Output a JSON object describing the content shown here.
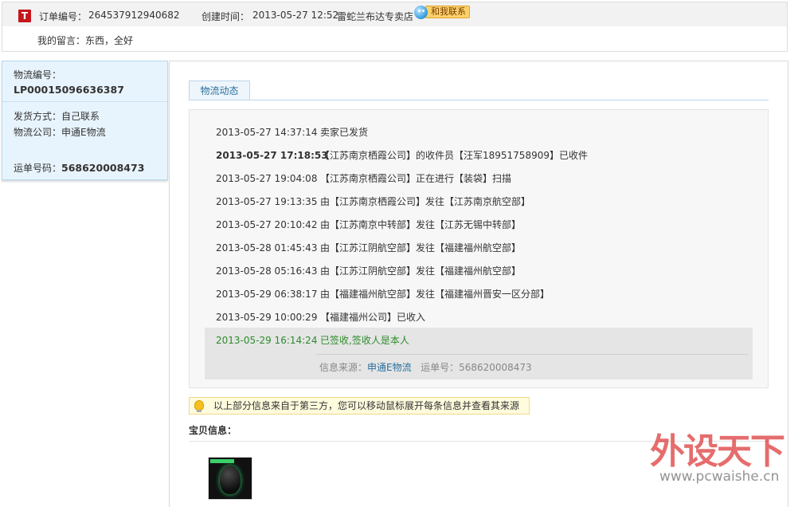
{
  "order": {
    "logo": "T",
    "order_no_label": "订单编号：",
    "order_no": "264537912940682",
    "created_label": "创建时间：",
    "created": "2013-05-27 12:52",
    "shop": "雷蛇兰布达专卖店",
    "contact_label": "和我联系"
  },
  "message": {
    "label": "我的留言：",
    "text": "东西，全好"
  },
  "logistics": {
    "no_label": "物流编号：",
    "no": "LP00015096636387",
    "ship_method_label": "发货方式：",
    "ship_method": "自己联系",
    "company_label": "物流公司：",
    "company": "申通E物流",
    "waybill_label": "运单号码：",
    "waybill": "568620008473"
  },
  "tab": {
    "label": "物流动态"
  },
  "timeline": [
    {
      "time": "2013-05-27 14:37:14",
      "event": "卖家已发货"
    },
    {
      "time": "2013-05-27 17:18:53",
      "event": "【江苏南京栖霞公司】的收件员【汪军18951758909】已收件"
    },
    {
      "time": "2013-05-27 19:04:08",
      "event": "【江苏南京栖霞公司】正在进行【装袋】扫描"
    },
    {
      "time": "2013-05-27 19:13:35",
      "event": "由【江苏南京栖霞公司】发往【江苏南京航空部】"
    },
    {
      "time": "2013-05-27 20:10:42",
      "event": "由【江苏南京中转部】发往【江苏无锡中转部】"
    },
    {
      "time": "2013-05-28 01:45:43",
      "event": "由【江苏江阴航空部】发往【福建福州航空部】"
    },
    {
      "time": "2013-05-28 05:16:43",
      "event": "由【江苏江阴航空部】发往【福建福州航空部】"
    },
    {
      "time": "2013-05-29 06:38:17",
      "event": "由【福建福州航空部】发往【福建福州晋安一区分部】"
    },
    {
      "time": "2013-05-29 10:00:29",
      "event": "【福建福州公司】已收入"
    },
    {
      "time": "2013-05-29 16:14:24",
      "event": "已签收,签收人是本人"
    }
  ],
  "source": {
    "label": "信息来源：",
    "link": "申通E物流",
    "waybill_label": "运单号：",
    "waybill": "568620008473"
  },
  "notice": {
    "text": "以上部分信息来自于第三方，您可以移动鼠标展开每条信息并查看其来源"
  },
  "baby": {
    "title": "宝贝信息："
  },
  "watermark": {
    "big": "外设天下",
    "url": "www.pcwaishe.cn"
  },
  "colors": {
    "accent": "#2a6f9e",
    "signed": "#2e8b2e",
    "logo": "#c4161c"
  }
}
